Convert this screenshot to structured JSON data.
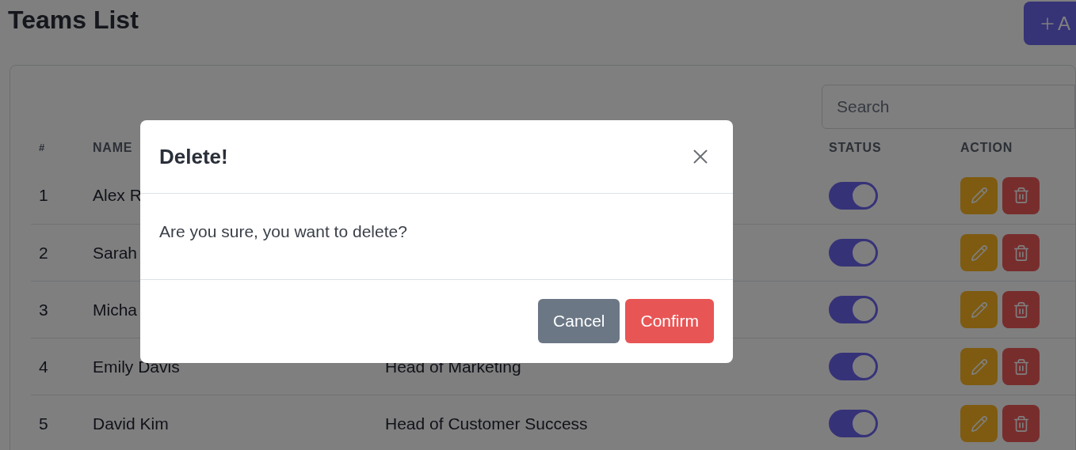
{
  "page": {
    "title": "Teams List",
    "add_button": {
      "label": "A"
    }
  },
  "search": {
    "placeholder": "Search"
  },
  "table": {
    "columns": [
      "#",
      "NAME",
      "STATUS",
      "ACTION"
    ],
    "rows": [
      {
        "index": "1",
        "name": "Alex R",
        "on": true
      },
      {
        "index": "2",
        "name": "Sarah",
        "on": true
      },
      {
        "index": "3",
        "name": "Micha",
        "on": true
      },
      {
        "index": "4",
        "name": "Emily Davis",
        "role": "Head of Marketing",
        "on": true
      },
      {
        "index": "5",
        "name": "David Kim",
        "role": "Head of Customer Success",
        "on": true
      }
    ]
  },
  "dialog": {
    "title": "Delete!",
    "message": "Are you sure, you want to delete?",
    "buttons": [
      {
        "label": "Cancel",
        "kind": "secondary"
      },
      {
        "label": "Confirm",
        "kind": "danger"
      }
    ]
  }
}
